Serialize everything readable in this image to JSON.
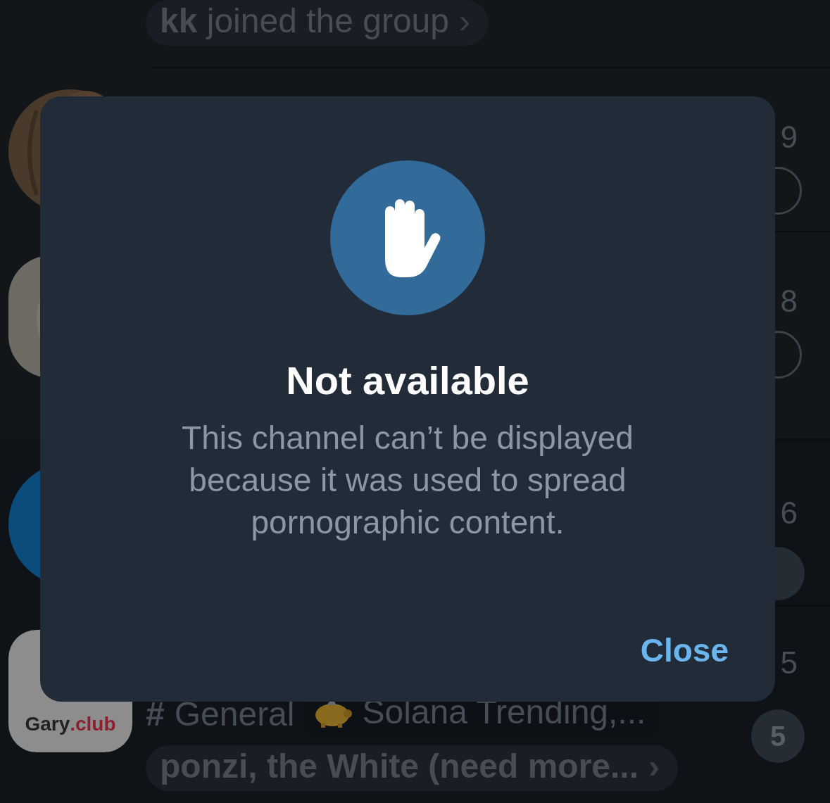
{
  "chat_list": [
    {
      "kind": "joined",
      "preview": "**kk** joined the group",
      "chevron": "›"
    },
    {
      "kind": "chat",
      "time": "9",
      "status_icon": true,
      "badge": false
    },
    {
      "kind": "chat",
      "time": "8",
      "status_icon": true,
      "badge": false
    },
    {
      "kind": "chat",
      "time": "6",
      "status_icon": false,
      "badge": true
    },
    {
      "kind": "topics",
      "logo": [
        "Gary",
        ".club"
      ],
      "time": "5",
      "topic_mark": "#",
      "topic": "General",
      "tag": "Solana Trending,...",
      "message": "ponzi, the White (need more...",
      "chevron": "›",
      "badge": "5"
    }
  ],
  "dialog": {
    "title": "Not available",
    "message": "This channel can’t be displayed because it was used to spread pornographic content.",
    "buttons": [
      "Close"
    ]
  }
}
